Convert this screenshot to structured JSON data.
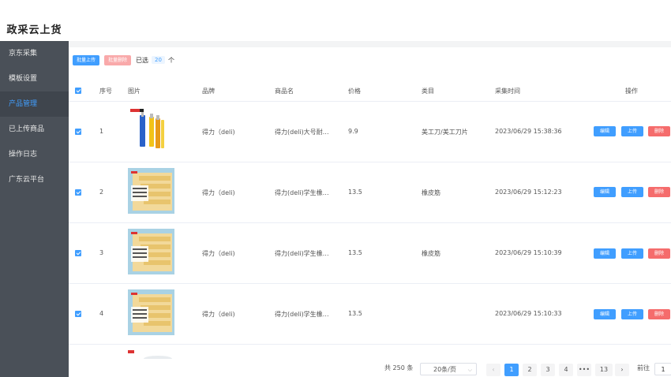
{
  "app": {
    "title": "政采云上货"
  },
  "sidebar": {
    "items": [
      {
        "label": "京东采集"
      },
      {
        "label": "模板设置"
      },
      {
        "label": "产品管理"
      },
      {
        "label": "已上传商品"
      },
      {
        "label": "操作日志"
      },
      {
        "label": "广东云平台"
      }
    ],
    "active_index": 2
  },
  "toolbar": {
    "batch_upload": "批量上传",
    "batch_delete": "批量删除",
    "selected_prefix": "已选",
    "selected_count": "20",
    "selected_suffix": "个"
  },
  "table": {
    "headers": {
      "index": "序号",
      "image": "图片",
      "brand": "品牌",
      "name": "商品名",
      "price": "价格",
      "category": "类目",
      "time": "采集时间",
      "ops": "操作"
    },
    "rows": [
      {
        "index": "1",
        "brand": "得力（deli)",
        "name": "得力(deli)大号耐…",
        "price": "9.9",
        "category": "美工刀/美工刀片",
        "time": "2023/06/29 15:38:36",
        "image": "utility-knife-image"
      },
      {
        "index": "2",
        "brand": "得力（deli)",
        "name": "得力(deli)学生橡…",
        "price": "13.5",
        "category": "橡皮筋",
        "time": "2023/06/29 15:12:23",
        "image": "eraser-box-image"
      },
      {
        "index": "3",
        "brand": "得力（deli)",
        "name": "得力(deli)学生橡…",
        "price": "13.5",
        "category": "橡皮筋",
        "time": "2023/06/29 15:10:39",
        "image": "eraser-box-image"
      },
      {
        "index": "4",
        "brand": "得力（deli)",
        "name": "得力(deli)学生橡…",
        "price": "13.5",
        "category": "",
        "time": "2023/06/29 15:10:33",
        "image": "eraser-box-image"
      }
    ],
    "actions": {
      "edit": "编辑",
      "upload": "上传",
      "delete": "删除"
    }
  },
  "pagination": {
    "total": "共 250 条",
    "page_size": "20条/页",
    "pages": [
      "1",
      "2",
      "3",
      "4",
      "•••",
      "13"
    ],
    "current": "1",
    "goto_label": "前往",
    "goto_value": "1"
  },
  "colors": {
    "primary": "#409eff",
    "danger": "#f56c6c",
    "sidebar": "#4a5058"
  }
}
